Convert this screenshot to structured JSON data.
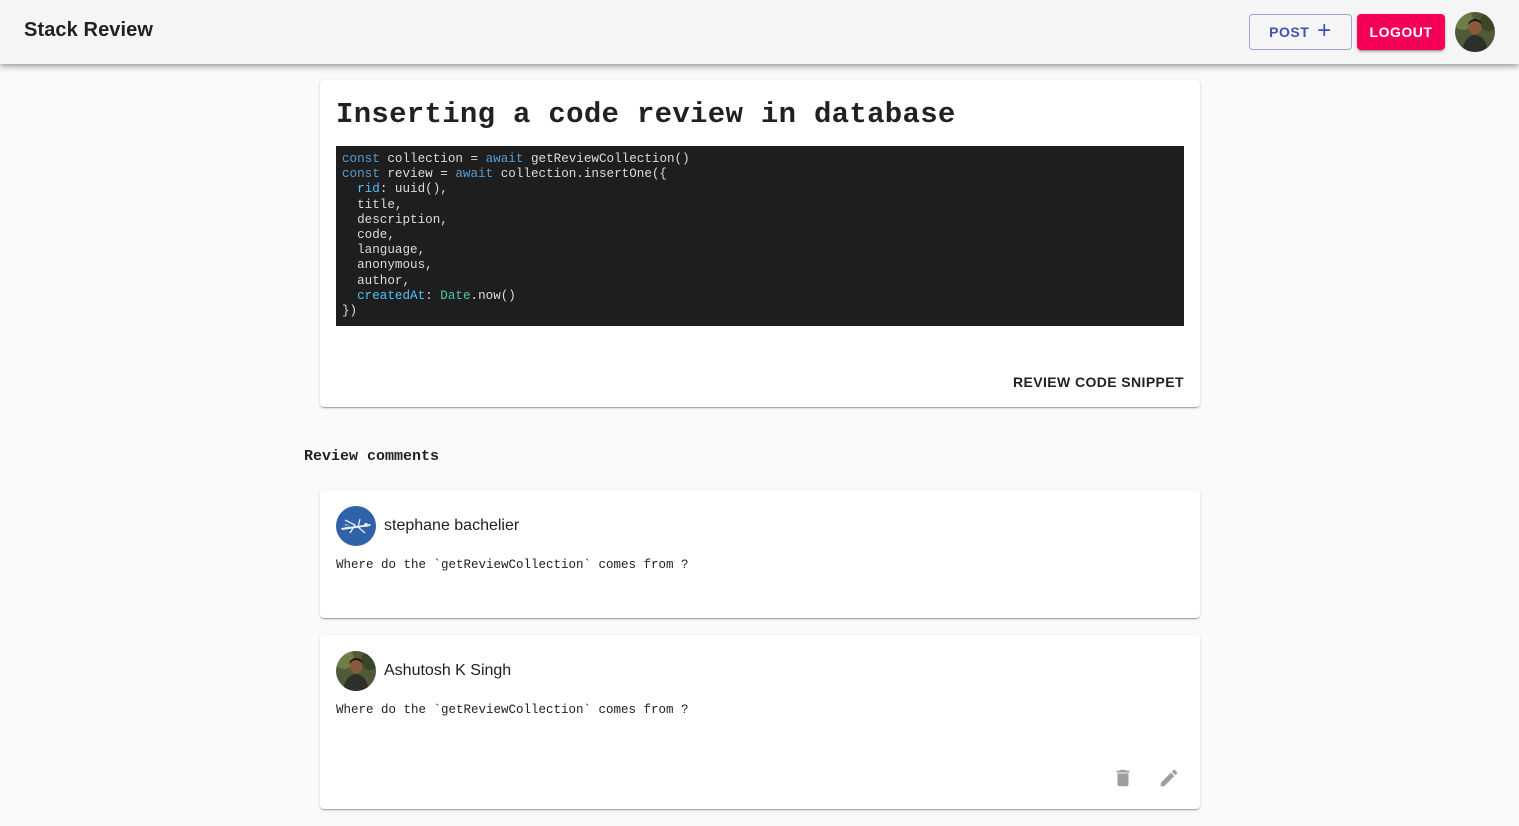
{
  "app": {
    "title": "Stack Review"
  },
  "toolbar": {
    "post_label": "POST",
    "post_icon": "plus-icon",
    "logout_label": "LOGOUT",
    "accent": "#f50057",
    "primary": "#3f51b5"
  },
  "post": {
    "title": "Inserting a code review in database",
    "code_lines": [
      "const collection = await getReviewCollection()",
      "const review = await collection.insertOne({",
      "  rid: uuid(),",
      "  title,",
      "  description,",
      "  code,",
      "  language,",
      "  anonymous,",
      "  author,",
      "  createdAt: Date.now()",
      "})"
    ],
    "action_label": "REVIEW CODE SNIPPET"
  },
  "comments_section": {
    "heading": "Review comments",
    "comments": [
      {
        "author": "stephane bachelier",
        "text": "Where do the `getReviewCollection` comes from ?",
        "editable": false
      },
      {
        "author": "Ashutosh K Singh",
        "text": "Where do the `getReviewCollection` comes from ?",
        "editable": true,
        "actions": [
          "delete-icon",
          "edit-icon"
        ]
      }
    ]
  }
}
